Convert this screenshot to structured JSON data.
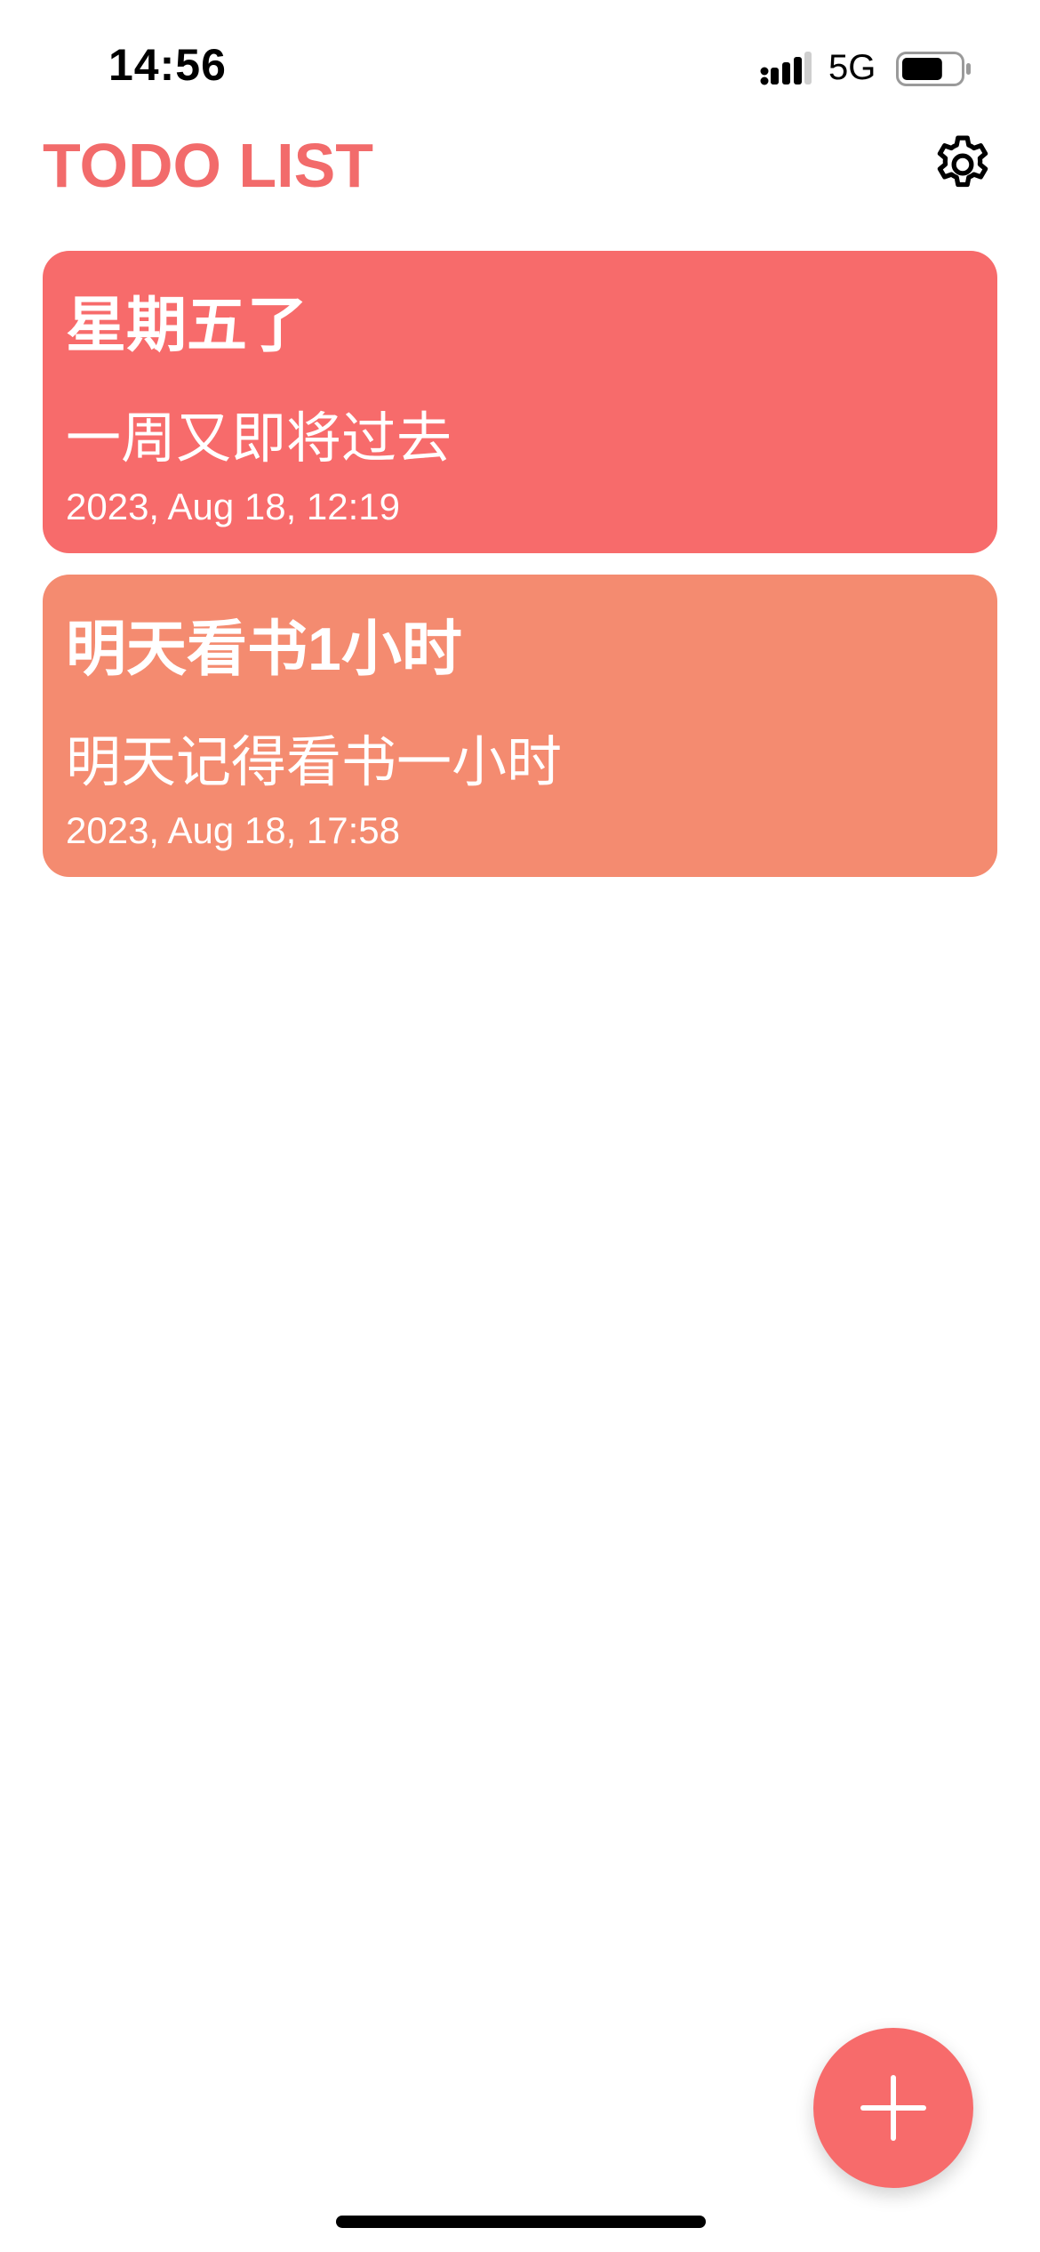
{
  "status_bar": {
    "time": "14:56",
    "network": "5G",
    "battery_level": 0.7,
    "signal_bars": 3
  },
  "header": {
    "title": "TODO LIST",
    "settings_icon": "gear-icon"
  },
  "todos": [
    {
      "title": "星期五了",
      "body": "一周又即将过去",
      "date": "2023, Aug 18, 12:19",
      "color": "#f76b6b"
    },
    {
      "title": "明天看书1小时",
      "body": "明天记得看书一小时",
      "date": "2023, Aug 18, 17:58",
      "color": "#f48b70"
    }
  ],
  "fab": {
    "icon": "plus-icon",
    "color": "#f76b6b"
  },
  "colors": {
    "accent": "#f26b6b",
    "background": "#ffffff"
  }
}
